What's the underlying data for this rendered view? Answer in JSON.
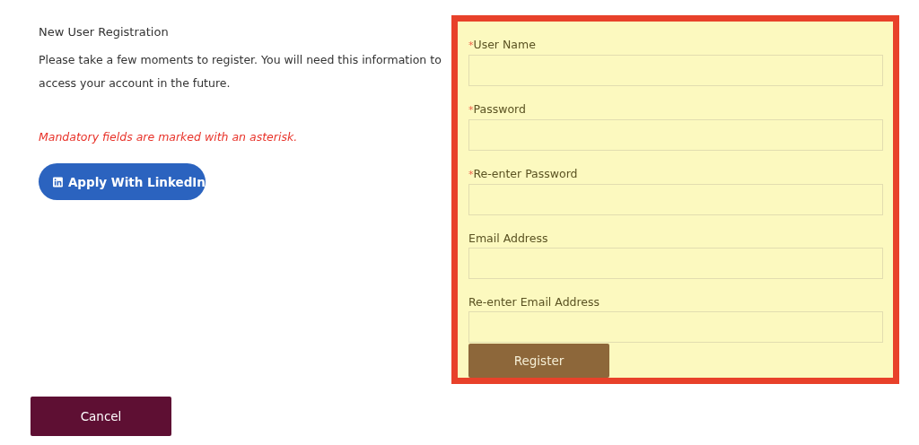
{
  "heading": "New User Registration",
  "intro": "Please take a few moments to register. You will need this information to access your account in the future.",
  "mandatory_note": "Mandatory fields are marked with an asterisk.",
  "linkedin_button": {
    "label": "Apply With LinkedIn"
  },
  "form": {
    "fields": [
      {
        "label": "User Name",
        "required_mark": "*"
      },
      {
        "label": "Password",
        "required_mark": "*"
      },
      {
        "label": "Re-enter Password",
        "required_mark": "*"
      },
      {
        "label": "Email Address"
      },
      {
        "label": "Re-enter Email Address"
      }
    ],
    "submit": "Register"
  },
  "cancel": "Cancel"
}
